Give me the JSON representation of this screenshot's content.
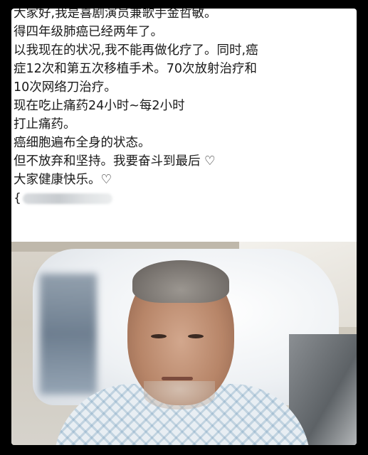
{
  "post": {
    "lines": [
      "大家好,我是喜剧演员兼歌手金哲敏。",
      "得四年级肺癌已经两年了。",
      "以我现在的状况,我不能再做化疗了。同时,癌",
      "症12次和第五次移植手术。70次放射治疗和",
      "10次网络刀治疗。",
      "现在吃止痛药24小时~每2小时",
      "打止痛药。",
      "癌细胞遍布全身的状态。",
      "但不放弃和坚持。我要奋斗到最后 ♡",
      "大家健康快乐。♡"
    ],
    "handle_prefix": "{"
  },
  "colors": {
    "background": "#000000",
    "card": "#ffffff",
    "text": "#1a1a1a"
  }
}
